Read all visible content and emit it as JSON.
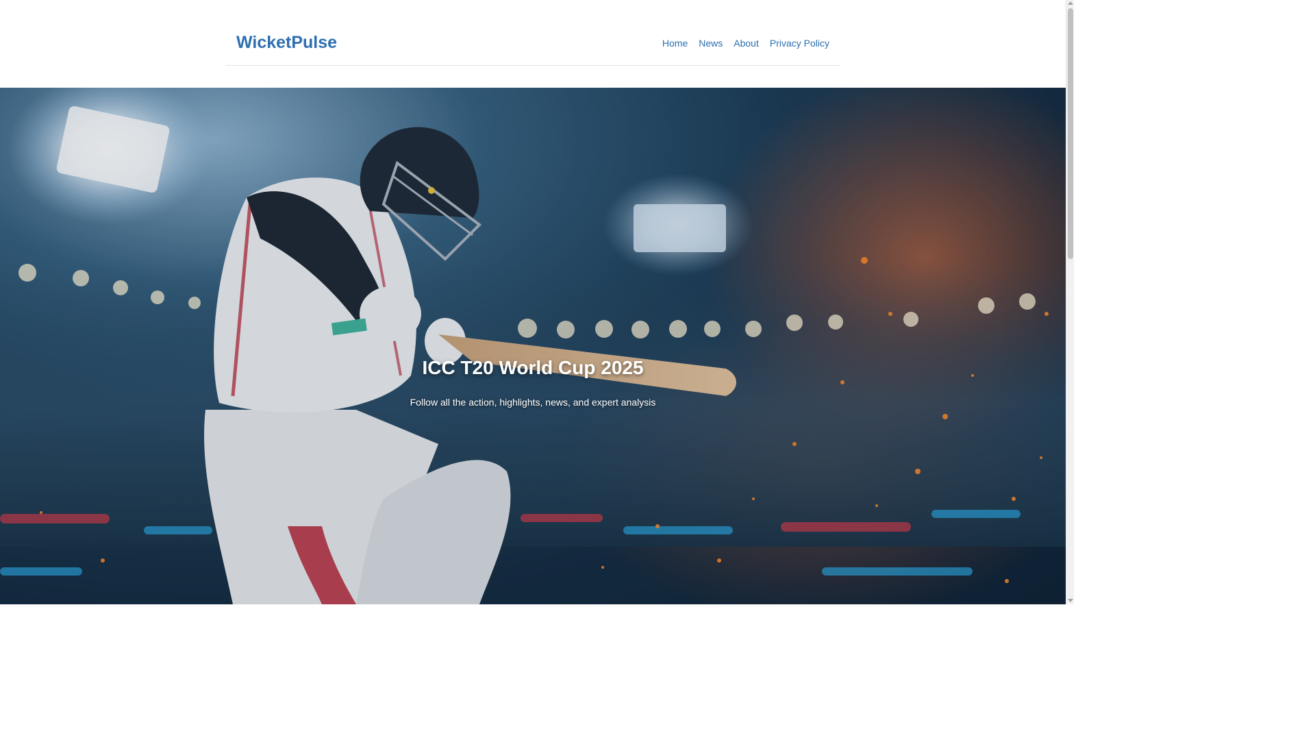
{
  "site": {
    "logo": "WicketPulse"
  },
  "nav": {
    "items": [
      {
        "label": "Home"
      },
      {
        "label": "News"
      },
      {
        "label": "About"
      },
      {
        "label": "Privacy Policy"
      }
    ]
  },
  "hero": {
    "title": "ICC T20 World Cup 2025",
    "subtitle": "Follow all the action, highlights, news, and expert analysis",
    "image_icon": "cricket-batsman-photo"
  },
  "colors": {
    "brand": "#2d6fb0",
    "hero_overlay": "#1d3d57"
  }
}
